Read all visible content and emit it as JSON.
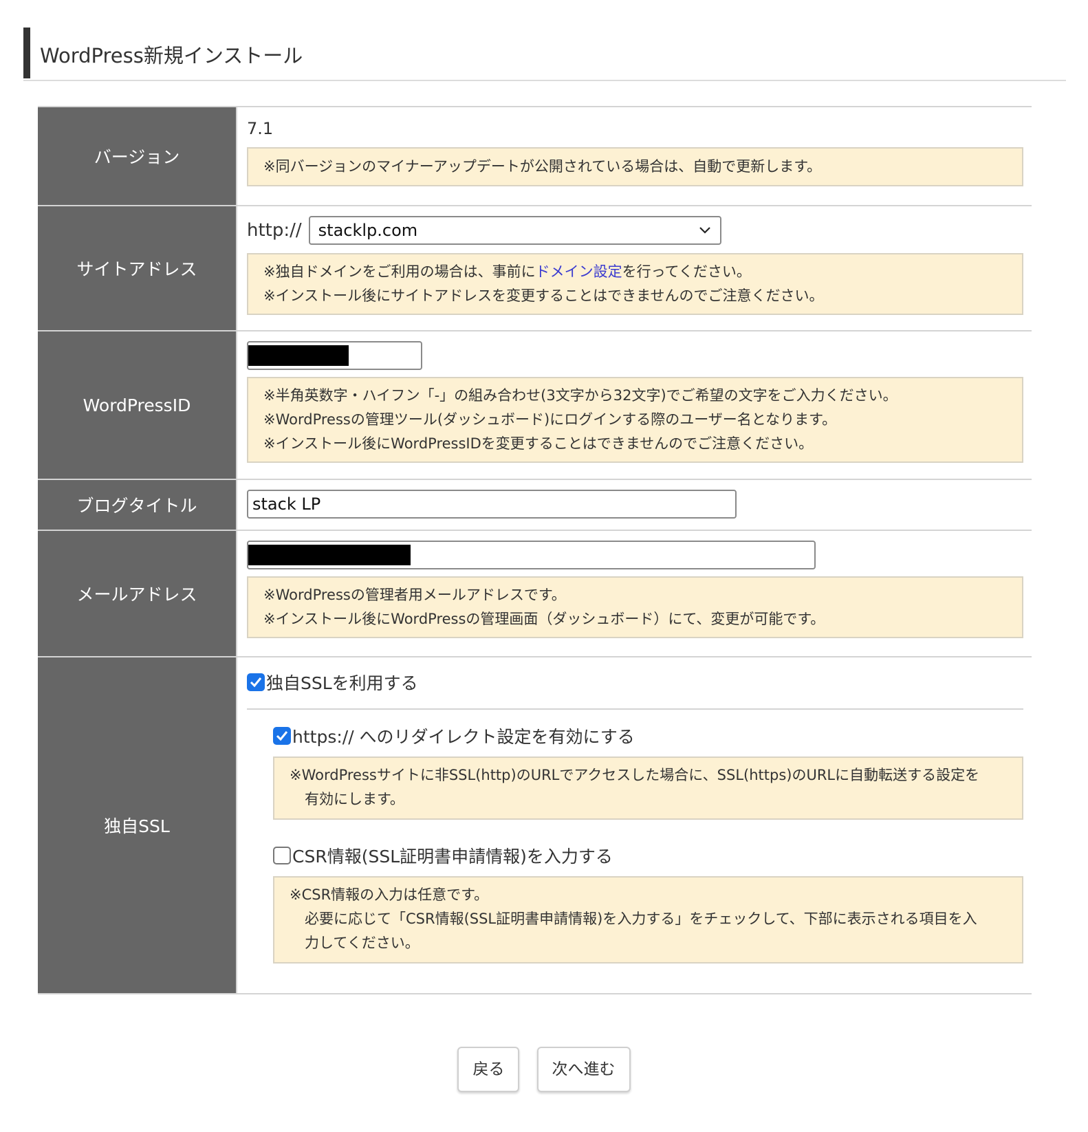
{
  "page": {
    "title": "WordPress新規インストール"
  },
  "rows": {
    "version": {
      "label": "バージョン",
      "value": "7.1",
      "note": "※同バージョンのマイナーアップデートが公開されている場合は、自動で更新します。"
    },
    "site_address": {
      "label": "サイトアドレス",
      "prefix": "http://",
      "selected_domain": "stacklp.com",
      "note1_before": "※独自ドメインをご利用の場合は、事前に",
      "note1_link": "ドメイン設定",
      "note1_after": "を行ってください。",
      "note2": "※インストール後にサイトアドレスを変更することはできませんのでご注意ください。"
    },
    "wordpress_id": {
      "label": "WordPressID",
      "value_redacted": 0.6,
      "note1": "※半角英数字・ハイフン「-」の組み合わせ(3文字から32文字)でご希望の文字をご入力ください。",
      "note2": "※WordPressの管理ツール(ダッシュボード)にログインする際のユーザー名となります。",
      "note3": "※インストール後にWordPressIDを変更することはできませんのでご注意ください。"
    },
    "blog_title": {
      "label": "ブログタイトル",
      "value": "stack LP"
    },
    "email": {
      "label": "メールアドレス",
      "value_redacted": 0.29,
      "note1": "※WordPressの管理者用メールアドレスです。",
      "note2": "※インストール後にWordPressの管理画面（ダッシュボード）にて、変更が可能です。"
    },
    "ssl": {
      "label": "独自SSL",
      "use_ssl_label": "独自SSLを利用する",
      "use_ssl_checked": true,
      "redirect_label": "https:// へのリダイレクト設定を有効にする",
      "redirect_checked": true,
      "redirect_note1": "※WordPressサイトに非SSL(http)のURLでアクセスした場合に、SSL(https)のURLに自動転送する設定を",
      "redirect_note2": "有効にします。",
      "csr_label": "CSR情報(SSL証明書申請情報)を入力する",
      "csr_checked": false,
      "csr_note1": "※CSR情報の入力は任意です。",
      "csr_note2": "必要に応じて「CSR情報(SSL証明書申請情報)を入力する」をチェックして、下部に表示される項目を入",
      "csr_note3": "力してください。"
    }
  },
  "buttons": {
    "back": "戻る",
    "next": "次へ進む"
  },
  "colors": {
    "header_cell": "#666666",
    "note_bg": "#fdf1d3",
    "link": "#3b3bd0",
    "checkbox_on": "#1a73e8"
  },
  "icons": {
    "select_arrow": "chevron-down-icon",
    "checkmark": "checkmark-icon"
  }
}
